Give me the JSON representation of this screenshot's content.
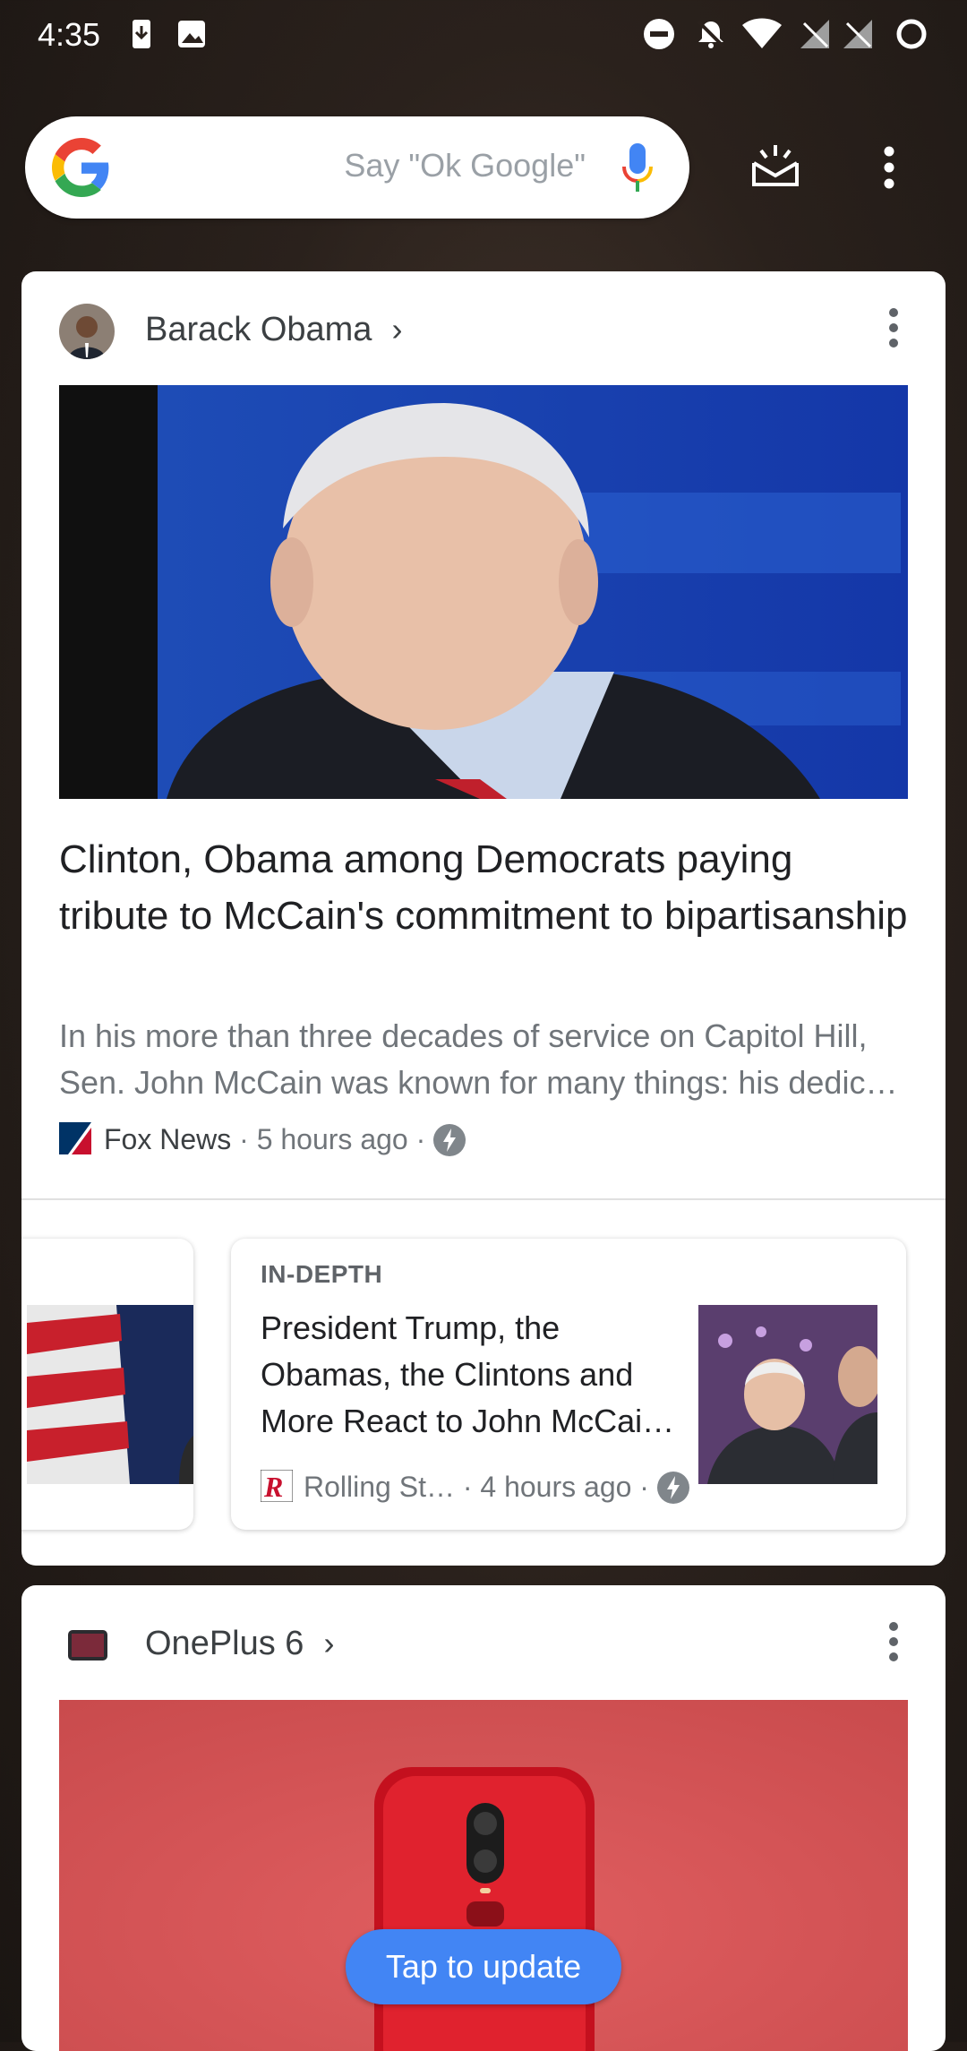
{
  "status_bar": {
    "time": "4:35",
    "icons_left": [
      "download-icon",
      "image-icon"
    ],
    "icons_right": [
      "do-not-disturb-icon",
      "notifications-off-icon",
      "wifi-icon",
      "no-signal-icon",
      "no-signal-icon",
      "loading-circle-icon"
    ]
  },
  "search": {
    "placeholder": "Say \"Ok Google\""
  },
  "colors": {
    "google_blue": "#4285F4",
    "google_red": "#EA4335",
    "google_yellow": "#FBBC05",
    "google_green": "#34A853",
    "toast_bg": "#4285F4"
  },
  "feed": {
    "card1": {
      "topic": "Barack Obama",
      "headline": "Clinton, Obama among Democrats paying tribute to McCain's commitment to bipartisanship",
      "snippet": "In his more than three decades of service on Capitol Hill, Sen. John McCain was known for many things: his dedic…",
      "source": "Fox News",
      "time": "5 hours ago",
      "related": {
        "kicker": "IN-DEPTH",
        "title": "President Trump, the Obamas, the Clintons and More React to John McCai…",
        "source": "Rolling St…",
        "time": "4 hours ago"
      }
    },
    "card2": {
      "topic": "OnePlus 6"
    }
  },
  "toast": {
    "label": "Tap to update"
  }
}
